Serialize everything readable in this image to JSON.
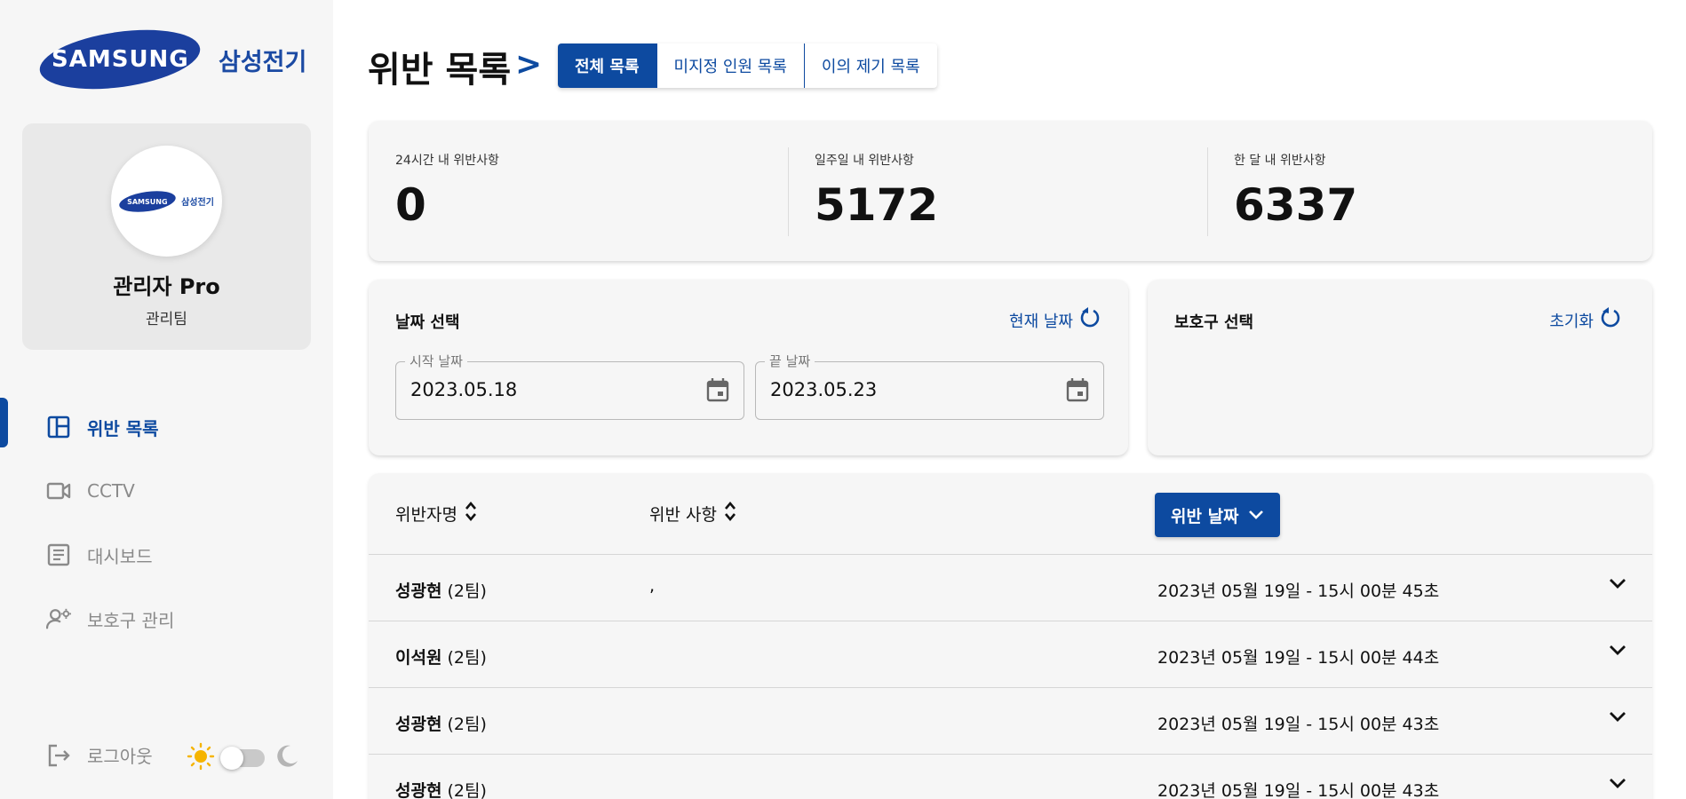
{
  "sidebar": {
    "brand_logo": "SAMSUNG",
    "brand_korean": "삼성전기",
    "profile": {
      "avatar_logo": "SAMSUNG",
      "avatar_korean": "삼성전기",
      "name": "관리자 Pro",
      "team": "관리팀"
    },
    "nav": [
      {
        "label": "위반 목록",
        "icon": "layout-icon",
        "active": true
      },
      {
        "label": "CCTV",
        "icon": "video-camera-icon",
        "active": false
      },
      {
        "label": "대시보드",
        "icon": "document-icon",
        "active": false
      },
      {
        "label": "보호구 관리",
        "icon": "user-gear-icon",
        "active": false
      }
    ],
    "logout_label": "로그아웃",
    "theme": {
      "light_icon": "sun-icon",
      "dark_icon": "moon-icon",
      "dark_mode": false
    }
  },
  "header": {
    "title": "위반 목록",
    "separator": ">",
    "tabs": [
      {
        "label": "전체 목록",
        "active": true
      },
      {
        "label": "미지정 인원 목록",
        "active": false
      },
      {
        "label": "이의 제기 목록",
        "active": false
      }
    ]
  },
  "stats": [
    {
      "label": "24시간 내 위반사항",
      "value": "0"
    },
    {
      "label": "일주일 내 위반사항",
      "value": "5172"
    },
    {
      "label": "한 달 내 위반사항",
      "value": "6337"
    }
  ],
  "date_filter": {
    "title": "날짜 선택",
    "reset_label": "현재 날짜",
    "start": {
      "legend": "시작 날짜",
      "value": "2023.05.18"
    },
    "end": {
      "legend": "끝 날짜",
      "value": "2023.05.23"
    }
  },
  "gear_filter": {
    "title": "보호구 선택",
    "reset_label": "초기화"
  },
  "table": {
    "columns": {
      "name": "위반자명",
      "violation": "위반 사항",
      "date": "위반 날짜"
    },
    "rows": [
      {
        "name": "성광현",
        "team": "(2팀)",
        "violation": ",",
        "date": "2023년 05월 19일 - 15시 00분 45초"
      },
      {
        "name": "이석원",
        "team": "(2팀)",
        "violation": "",
        "date": "2023년 05월 19일 - 15시 00분 44초"
      },
      {
        "name": "성광현",
        "team": "(2팀)",
        "violation": "",
        "date": "2023년 05월 19일 - 15시 00분 43초"
      },
      {
        "name": "성광현",
        "team": "(2팀)",
        "violation": "",
        "date": "2023년 05월 19일 - 15시 00분 43초"
      }
    ]
  },
  "colors": {
    "primary": "#0d4aa0",
    "brand_blue": "#1b3f9e",
    "panel_bg": "#f6f6f6",
    "sun": "#f5b400"
  }
}
